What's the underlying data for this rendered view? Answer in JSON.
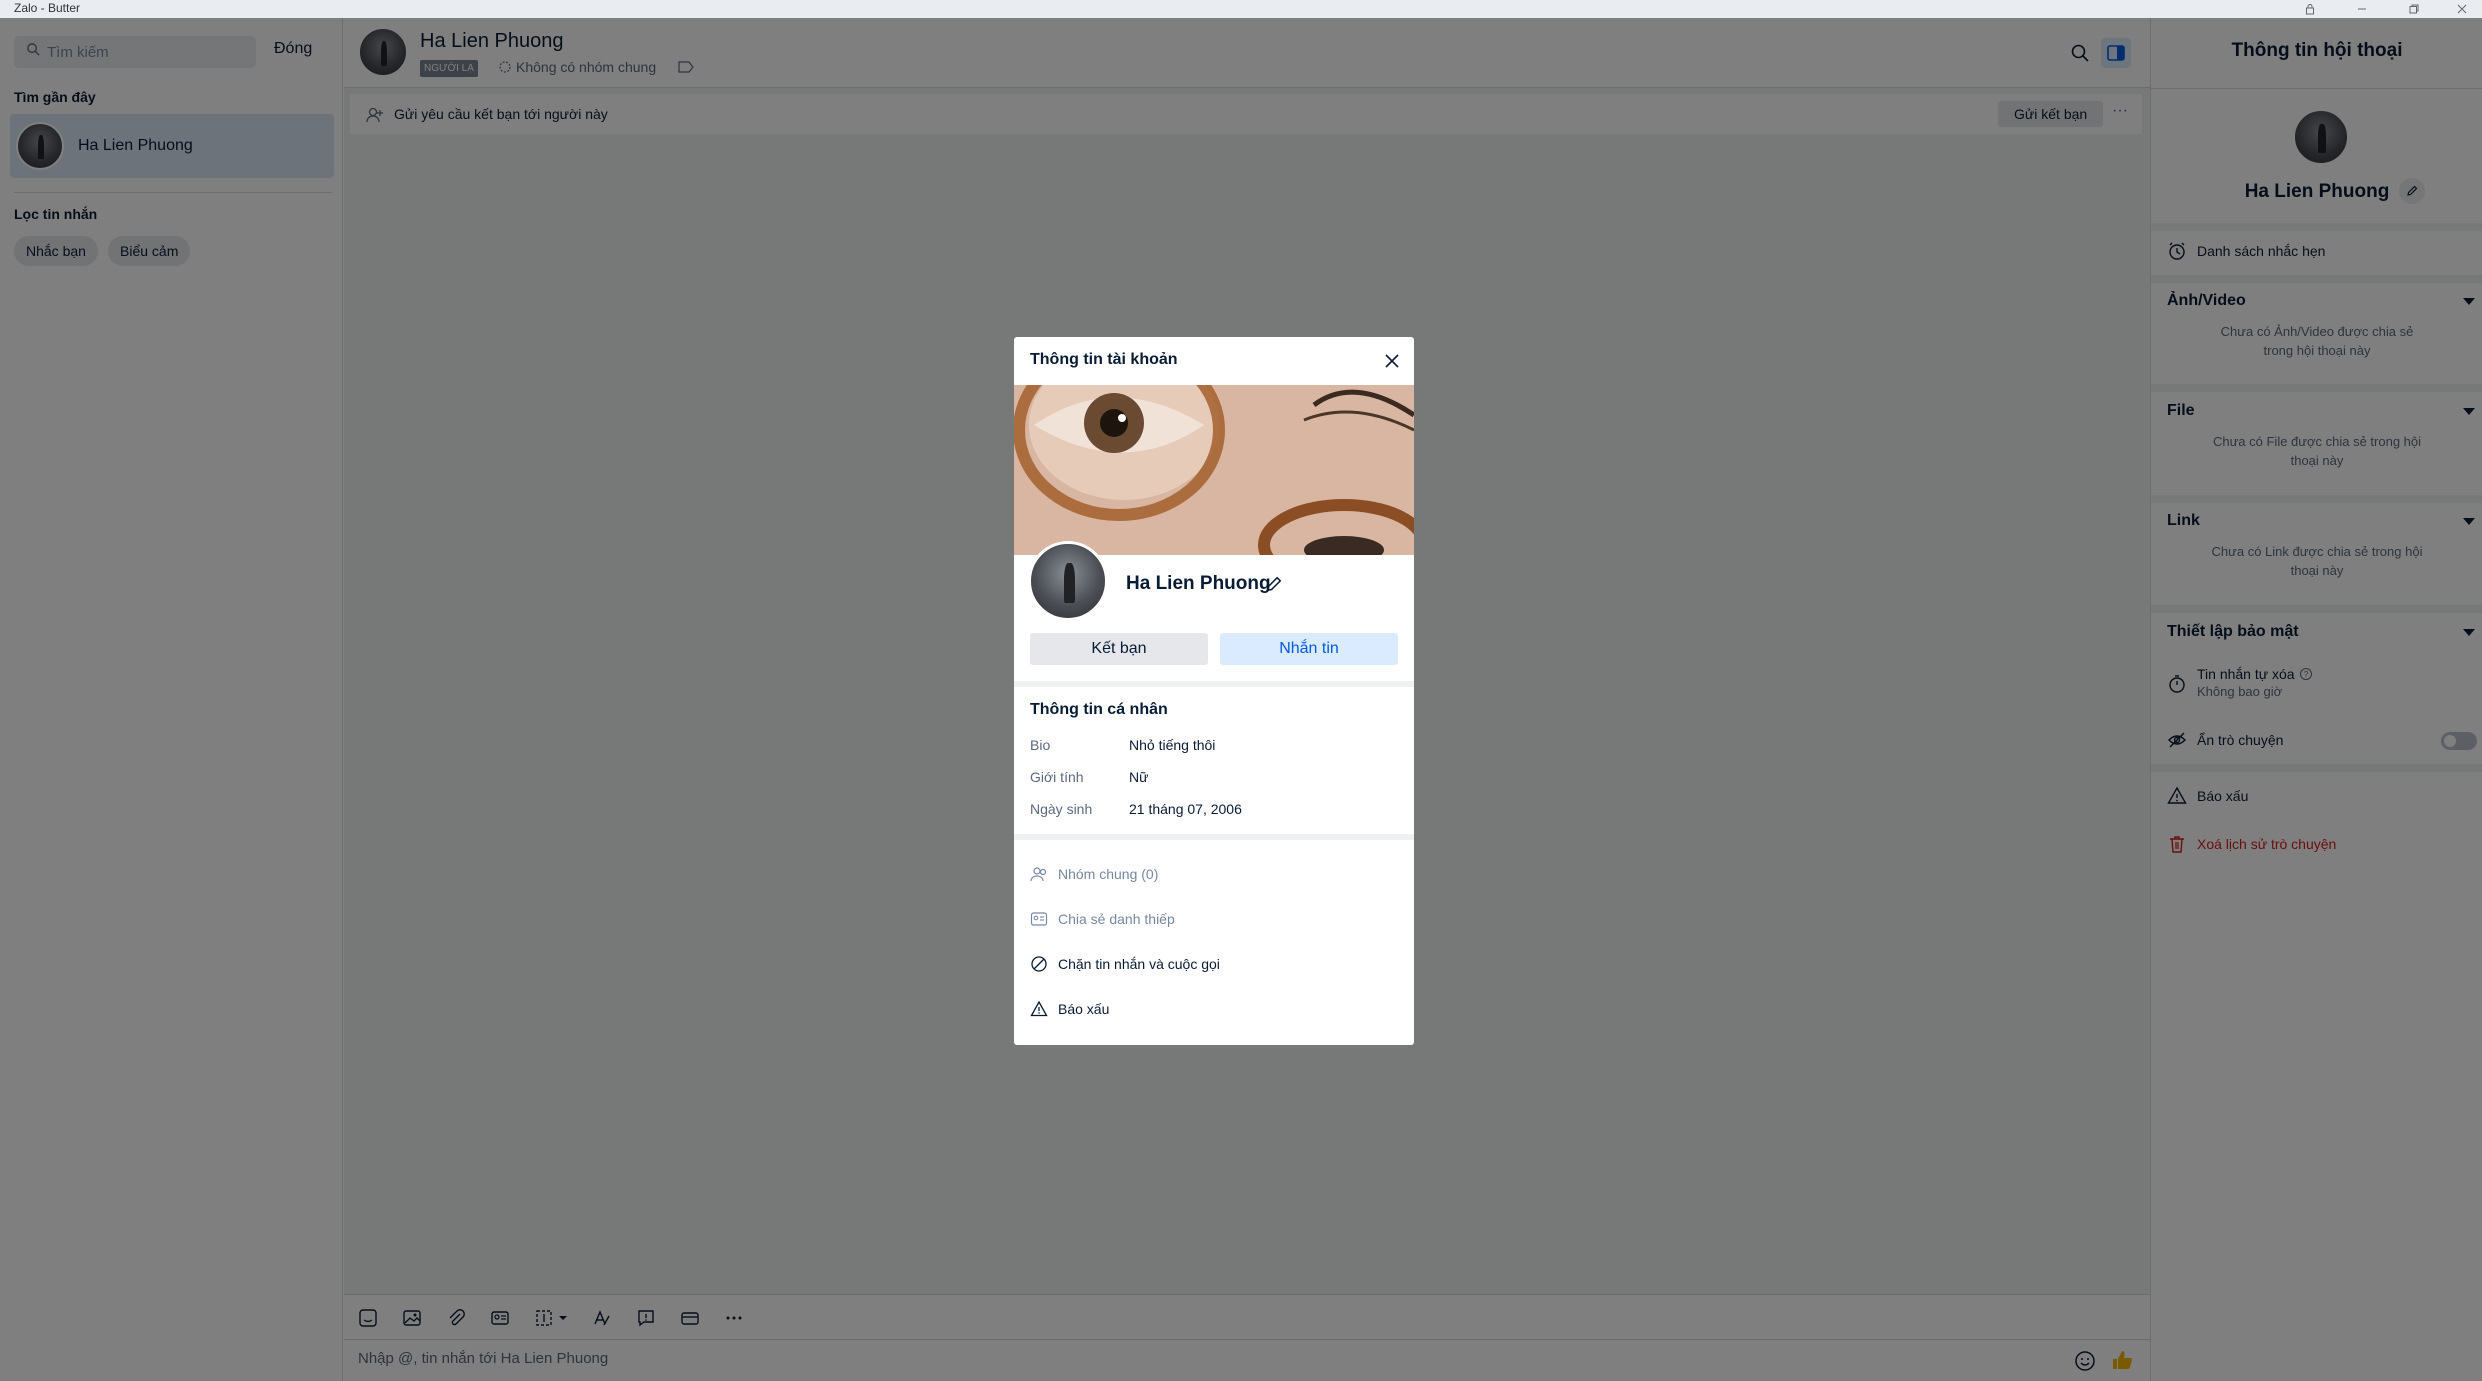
{
  "window": {
    "title": "Zalo - Butter"
  },
  "left": {
    "search_placeholder": "Tìm kiếm",
    "close_label": "Đóng",
    "recent_title": "Tìm gần đây",
    "recent_items": [
      {
        "name": "Ha Lien Phuong"
      }
    ],
    "filter_title": "Lọc tin nhắn",
    "filters": [
      "Nhắc bạn",
      "Biểu cảm"
    ]
  },
  "chat": {
    "name": "Ha Lien Phuong",
    "stranger_tag": "NGƯỜI LẠ",
    "common_groups": "Không có nhóm chung",
    "friend_request_text": "Gửi yêu cầu kết bạn tới người này",
    "friend_request_button": "Gửi kết bạn",
    "more": "···",
    "compose_placeholder": "Nhập @, tin nhắn tới Ha Lien Phuong"
  },
  "right": {
    "title": "Thông tin hội thoại",
    "name": "Ha Lien Phuong",
    "reminders": "Danh sách nhắc hẹn",
    "media_title": "Ảnh/Video",
    "media_empty": "Chưa có Ảnh/Video được chia sẻ trong hội thoại này",
    "file_title": "File",
    "file_empty": "Chưa có File được chia sẻ trong hội thoại này",
    "link_title": "Link",
    "link_empty": "Chưa có Link được chia sẻ trong hội thoại này",
    "security_title": "Thiết lập bảo mật",
    "self_destruct": "Tin nhắn tự xóa",
    "self_destruct_value": "Không bao giờ",
    "hide_chat": "Ẩn trò chuyện",
    "hide_chat_enabled": false,
    "report": "Báo xấu",
    "delete_history": "Xoá lịch sử trò chuyện",
    "delete_color": "#d91b1b"
  },
  "modal": {
    "title": "Thông tin tài khoản",
    "name": "Ha Lien Phuong",
    "add_friend": "Kết bạn",
    "message": "Nhắn tin",
    "personal_title": "Thông tin cá nhân",
    "fields": [
      {
        "label": "Bio",
        "value": "Nhỏ tiếng thôi"
      },
      {
        "label": "Giới tính",
        "value": "Nữ"
      },
      {
        "label": "Ngày sinh",
        "value": "21 tháng 07, 2006"
      }
    ],
    "actions": [
      {
        "label": "Nhóm chung (0)",
        "icon": "group-icon",
        "enabled": false
      },
      {
        "label": "Chia sẻ danh thiếp",
        "icon": "contact-card-icon",
        "enabled": false
      },
      {
        "label": "Chặn tin nhắn và cuộc gọi",
        "icon": "block-icon",
        "enabled": true
      },
      {
        "label": "Báo xấu",
        "icon": "warning-icon",
        "enabled": true
      }
    ]
  },
  "colors": {
    "accent": "#005ae0",
    "text": "#081c36",
    "secondary": "#5a6981",
    "danger": "#d91b1b"
  }
}
